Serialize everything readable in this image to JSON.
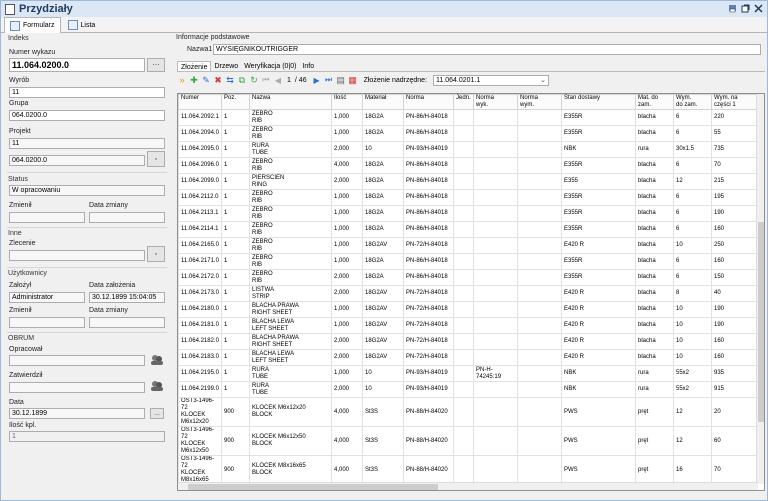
{
  "window": {
    "title": "Przydziały"
  },
  "tabs": [
    {
      "label": "Formularz"
    },
    {
      "label": "Lista"
    }
  ],
  "left": {
    "indeks": "Indeks",
    "numer_wykazu_label": "Numer wykazu",
    "numer_wykazu": "11.064.0200.0",
    "wyrob_label": "Wyrób",
    "wyrob": "11",
    "grupa_label": "Grupa",
    "grupa": "064.0200.0",
    "projekt_label": "Projekt",
    "projekt1": "11",
    "projekt2": "064.0200.0",
    "status_section": "Status",
    "status": "W opracowaniu",
    "zmienil_label": "Zmienił",
    "data_zmiany_label": "Data zmiany",
    "inne_section": "Inne",
    "zlecenie_label": "Zlecenie",
    "uzytkownicy_section": "Użytkownicy",
    "zalozyl_label": "Założył",
    "zalozyl": "Administrator",
    "data_zalozenia_label": "Data założenia",
    "data_zalozenia": "30.12.1899 15:04:05",
    "zmienil2_label": "Zmienił",
    "data_zmiany2_label": "Data zmiany",
    "obrum_section": "OBRUM",
    "opracowal_label": "Opracował",
    "zatwierdzil_label": "Zatwierdził",
    "data_label": "Data",
    "data": "30.12.1899",
    "ilosc_label": "Ilość kpl.",
    "ilosc": "1",
    "ellipsis": "..."
  },
  "right": {
    "info_section": "Informacje podstawowe",
    "nazwa1_label": "Nazwa1",
    "nazwa1": "WYSIĘGNIKOUTRIGGER",
    "subtabs": [
      {
        "label": "Złożenie"
      },
      {
        "label": "Drzewo"
      },
      {
        "label": "Weryfikacja (0|0)"
      },
      {
        "label": "Info"
      }
    ],
    "page_current": "1",
    "page_total": "/ 46",
    "zlozenie_label": "Złożenie nadrzędne:",
    "zlozenie_value": "11.064.0201.1"
  },
  "table": {
    "headers": [
      "Numer",
      "Poz.",
      "Nazwa",
      "Ilość",
      "Materiał",
      "Norma",
      "Jedn.",
      "Norma\nwyk.",
      "Norma\nwym.",
      "Stan dostawy",
      "Mat. do\nzam.",
      "Wym.\ndo zam.",
      "Wym. na\nczęści 1"
    ],
    "rows": [
      [
        "11.064.2092.1",
        "1",
        "ŻEBRO\nRIB",
        "1,000",
        "18G2A",
        "PN-86/H-84018",
        "",
        "",
        "",
        "E355R",
        "blacha",
        "6",
        "220"
      ],
      [
        "11.064.2094.0",
        "1",
        "ŻEBRO\nRIB",
        "1,000",
        "18G2A",
        "PN-86/H-84018",
        "",
        "",
        "",
        "E355R",
        "blacha",
        "6",
        "55"
      ],
      [
        "11.064.2095.0",
        "1",
        "RURA\nTUBE",
        "2,000",
        "10",
        "PN-93/H-84019",
        "",
        "",
        "",
        "NBK",
        "rura",
        "30x1.5",
        "735"
      ],
      [
        "11.064.2096.0",
        "1",
        "ŻEBRO\nRIB",
        "4,000",
        "18G2A",
        "PN-86/H-84018",
        "",
        "",
        "",
        "E355R",
        "blacha",
        "6",
        "70"
      ],
      [
        "11.064.2099.0",
        "1",
        "PIERŚCIEŃ\nRING",
        "2,000",
        "18G2A",
        "PN-86/H-84018",
        "",
        "",
        "",
        "E355",
        "blacha",
        "12",
        "215"
      ],
      [
        "11.064.2112.0",
        "1",
        "ŻEBRO\nRIB",
        "1,000",
        "18G2A",
        "PN-86/H-84018",
        "",
        "",
        "",
        "E355R",
        "blacha",
        "6",
        "195"
      ],
      [
        "11.064.2113.1",
        "1",
        "ŻEBRO\nRIB",
        "1,000",
        "18G2A",
        "PN-86/H-84018",
        "",
        "",
        "",
        "E355R",
        "blacha",
        "6",
        "190"
      ],
      [
        "11.064.2114.1",
        "1",
        "ŻEBRO\nRIB",
        "1,000",
        "18G2A",
        "PN-86/H-84018",
        "",
        "",
        "",
        "E355R",
        "blacha",
        "6",
        "160"
      ],
      [
        "11.064.2165.0",
        "1",
        "ŻEBRO\nRIB",
        "1,000",
        "18G2AV",
        "PN-72/H-84018",
        "",
        "",
        "",
        "E420 R",
        "blacha",
        "10",
        "250"
      ],
      [
        "11.064.2171.0",
        "1",
        "ŻEBRO\nRIB",
        "1,000",
        "18G2A",
        "PN-86/H-84018",
        "",
        "",
        "",
        "E355R",
        "blacha",
        "6",
        "160"
      ],
      [
        "11.064.2172.0",
        "1",
        "ŻEBRO\nRIB",
        "2,000",
        "18G2A",
        "PN-86/H-84018",
        "",
        "",
        "",
        "E355R",
        "blacha",
        "6",
        "150"
      ],
      [
        "11.064.2173.0",
        "1",
        "LISTWA\nSTRIP",
        "2,000",
        "18G2AV",
        "PN-72/H-84018",
        "",
        "",
        "",
        "E420 R",
        "blacha",
        "8",
        "40"
      ],
      [
        "11.064.2180.0",
        "1",
        "BLACHA PRAWA\nRIGHT SHEET",
        "1,000",
        "18G2AV",
        "PN-72/H-84018",
        "",
        "",
        "",
        "E420 R",
        "blacha",
        "10",
        "190"
      ],
      [
        "11.064.2181.0",
        "1",
        "BLACHA LEWA\nLEFT SHEET",
        "1,000",
        "18G2AV",
        "PN-72/H-84018",
        "",
        "",
        "",
        "E420 R",
        "blacha",
        "10",
        "190"
      ],
      [
        "11.064.2182.0",
        "1",
        "BLACHA PRAWA\nRIGHT SHEET",
        "2,000",
        "18G2AV",
        "PN-72/H-84018",
        "",
        "",
        "",
        "E420 R",
        "blacha",
        "10",
        "160"
      ],
      [
        "11.064.2183.0",
        "1",
        "BLACHA LEWA\nLEFT SHEET",
        "2,000",
        "18G2AV",
        "PN-72/H-84018",
        "",
        "",
        "",
        "E420 R",
        "blacha",
        "10",
        "160"
      ],
      [
        "11.064.2195.0",
        "1",
        "RURA\nTUBE",
        "1,000",
        "10",
        "PN-93/H-84019",
        "",
        "PN-H-74245:19",
        "",
        "NBK",
        "rura",
        "55x2",
        "935"
      ],
      [
        "11.064.2199.0",
        "1",
        "RURA\nTUBE",
        "2,000",
        "10",
        "PN-93/H-84019",
        "",
        "",
        "",
        "NBK",
        "rura",
        "55x2",
        "915"
      ],
      [
        "OST3-1496-72\nKLOCEK\nM6x12x20",
        "900",
        "KLOCEK M6x12x20\nBLOCK",
        "4,000",
        "St3S",
        "PN-88/H-84020",
        "",
        "",
        "",
        "PWS",
        "pręt",
        "12",
        "20"
      ],
      [
        "OST3-1496-72\nKLOCEK\nM6x12x50",
        "900",
        "KLOCEK M6x12x50\nBLOCK",
        "4,000",
        "St3S",
        "PN-88/H-84020",
        "",
        "",
        "",
        "PWS",
        "pręt",
        "12",
        "60"
      ],
      [
        "OST3-1496-72\nKLOCEK\nM8x16x65",
        "900",
        "KLOCEK M8x16x65\nBLOCK",
        "4,000",
        "St3S",
        "PN-88/H-84020",
        "",
        "",
        "",
        "PWS",
        "pręt",
        "16",
        "70"
      ]
    ]
  },
  "colors": {
    "accent": "#1e395b",
    "titlebar": "#dce7f5",
    "grid_border": "#8f8f8f",
    "green": "#3aa84a",
    "blue": "#2f6fd1",
    "red": "#d23b3b"
  }
}
